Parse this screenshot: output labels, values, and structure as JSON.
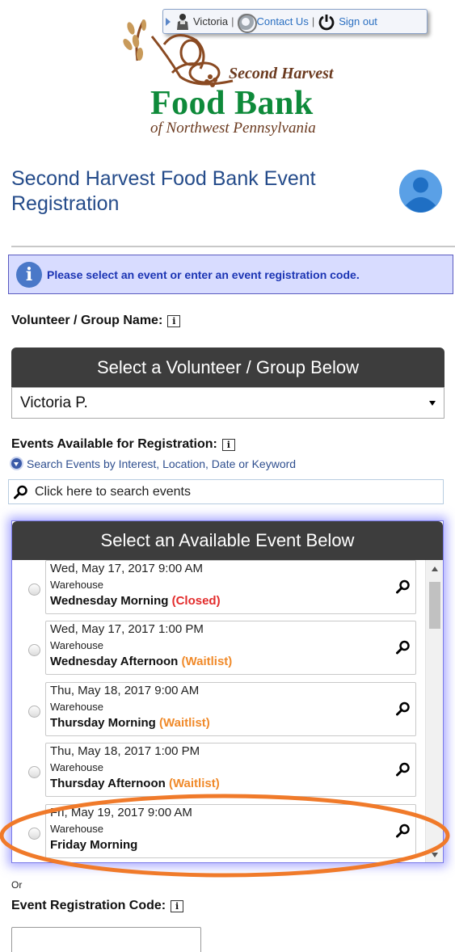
{
  "userbar": {
    "user_name": "Victoria",
    "sep": "|",
    "contact_label": "Contact Us",
    "signout_label": "Sign out"
  },
  "logo": {
    "line1": "Second Harvest",
    "line2": "Food Bank",
    "line3": "of Northwest Pennsylvania"
  },
  "page": {
    "title": "Second Harvest Food Bank Event Registration"
  },
  "info_banner": {
    "icon_letter": "i",
    "message": "Please select an event or enter an event registration code."
  },
  "volunteer": {
    "label": "Volunteer / Group Name:",
    "header": "Select a Volunteer / Group Below",
    "selected": "Victoria P."
  },
  "events": {
    "label": "Events Available for Registration:",
    "search_toggle": "Search Events by Interest, Location, Date or Keyword",
    "search_placeholder": "Click here to search events",
    "header": "Select an Available Event Below",
    "items": [
      {
        "date": "Wed, May 17, 2017 9:00 AM",
        "location": "Warehouse",
        "name": "Wednesday Morning",
        "status": "(Closed)"
      },
      {
        "date": "Wed, May 17, 2017 1:00 PM",
        "location": "Warehouse",
        "name": "Wednesday Afternoon",
        "status": "(Waitlist)"
      },
      {
        "date": "Thu, May 18, 2017 9:00 AM",
        "location": "Warehouse",
        "name": "Thursday Morning",
        "status": "(Waitlist)"
      },
      {
        "date": "Thu, May 18, 2017 1:00 PM",
        "location": "Warehouse",
        "name": "Thursday Afternoon",
        "status": "(Waitlist)"
      },
      {
        "date": "Fri, May 19, 2017 9:00 AM",
        "location": "Warehouse",
        "name": "Friday Morning",
        "status": ""
      }
    ]
  },
  "code": {
    "or_label": "Or",
    "label": "Event Registration Code:",
    "value": ""
  },
  "help_icon_letter": "i",
  "colors": {
    "accent_title": "#244b8a",
    "brand_green": "#0e8a3a",
    "closed": "#e32c2c",
    "waitlist": "#f08a2a",
    "annotation": "#f07a2a"
  },
  "icons": [
    "person-icon",
    "contact-lifering-icon",
    "power-icon",
    "info-icon",
    "help-icon",
    "chevron-down-icon",
    "search-icon",
    "avatar-icon"
  ]
}
